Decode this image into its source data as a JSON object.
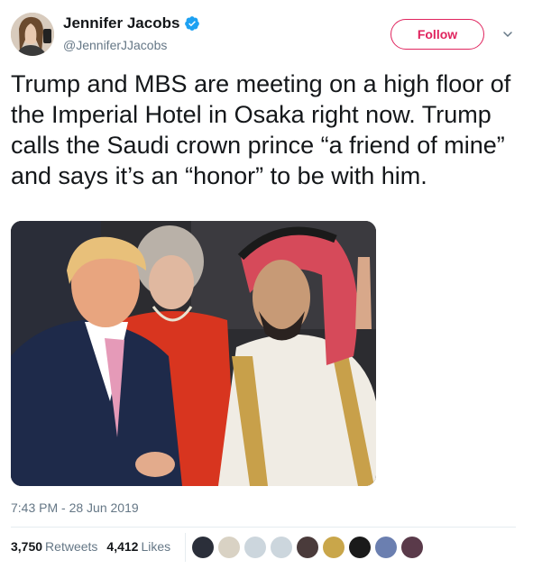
{
  "author": {
    "name": "Jennifer Jacobs",
    "handle": "@JenniferJJacobs",
    "verified_icon": "verified-badge-icon",
    "avatar": "profile-photo"
  },
  "follow_button": {
    "label": "Follow"
  },
  "menu": {
    "icon": "chevron-down-icon"
  },
  "tweet": {
    "text": "Trump and MBS are meeting on a high floor of the Imperial Hotel in Osaka right now. Trump calls the Saudi crown prince “a friend of mine” and says it’s an “honor” to be with him.",
    "timestamp": "7:43 PM - 28 Jun 2019"
  },
  "stats": {
    "retweets_count": "3,750",
    "retweets_label": "Retweets",
    "likes_count": "4,412",
    "likes_label": "Likes"
  },
  "likers": [
    {
      "name": "liker-avatar-1",
      "color": "#2b2f3a"
    },
    {
      "name": "liker-avatar-2",
      "color": "#d9d2c4"
    },
    {
      "name": "liker-avatar-3",
      "color": "#ccd6dd"
    },
    {
      "name": "liker-avatar-4",
      "color": "#ccd6dd"
    },
    {
      "name": "liker-avatar-5",
      "color": "#4a3b3b"
    },
    {
      "name": "liker-avatar-6",
      "color": "#c9a64a"
    },
    {
      "name": "liker-avatar-7",
      "color": "#1a1a1a"
    },
    {
      "name": "liker-avatar-8",
      "color": "#6b7fb0"
    },
    {
      "name": "liker-avatar-9",
      "color": "#5a3a4a"
    }
  ],
  "colors": {
    "follow_accent": "#e0245e",
    "verified_blue": "#1da1f2",
    "secondary_text": "#657786"
  }
}
